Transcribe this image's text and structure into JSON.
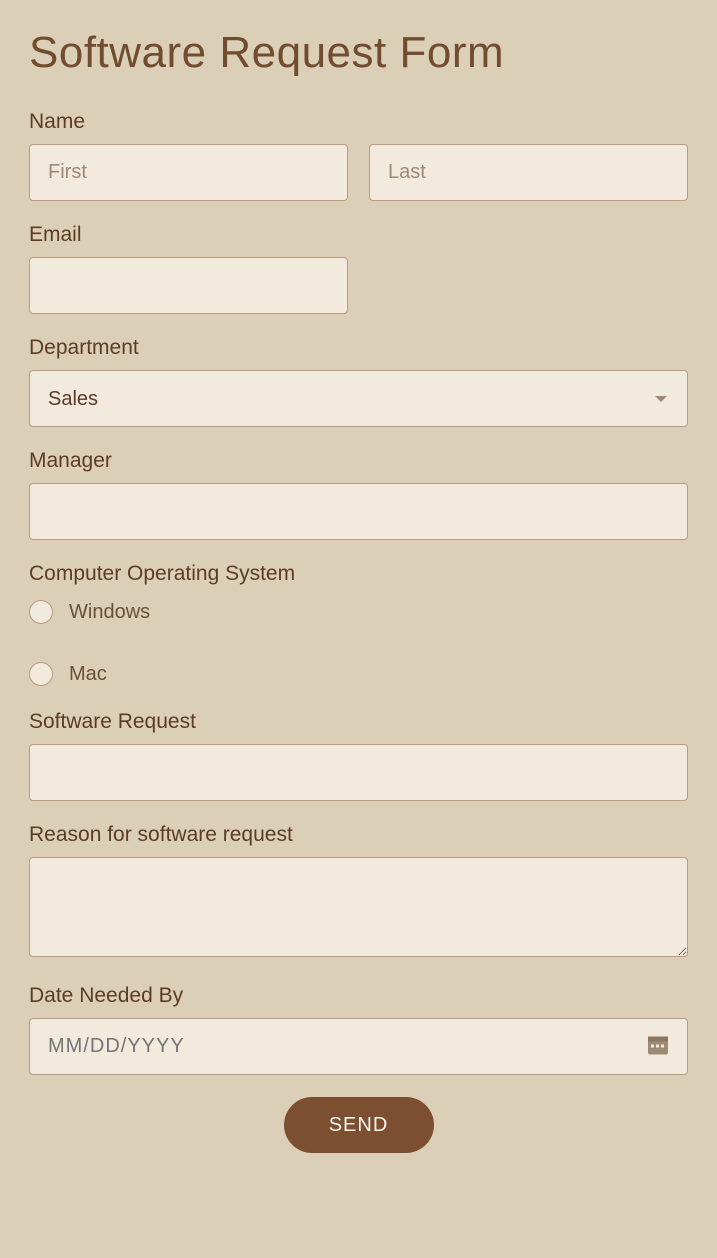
{
  "title": "Software Request Form",
  "fields": {
    "name": {
      "label": "Name",
      "first_placeholder": "First",
      "last_placeholder": "Last"
    },
    "email": {
      "label": "Email"
    },
    "department": {
      "label": "Department",
      "selected": "Sales"
    },
    "manager": {
      "label": "Manager"
    },
    "os": {
      "label": "Computer Operating System",
      "options": [
        "Windows",
        "Mac"
      ]
    },
    "software": {
      "label": "Software Request"
    },
    "reason": {
      "label": "Reason for software request"
    },
    "date": {
      "label": "Date Needed By",
      "placeholder": "MM/DD/YYYY"
    }
  },
  "submit": {
    "label": "SEND"
  }
}
